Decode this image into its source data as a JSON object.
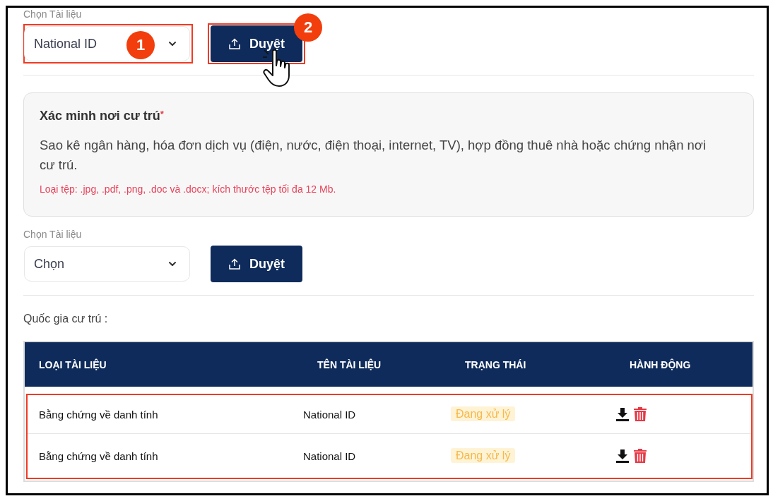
{
  "uploads": [
    {
      "label": "Chọn Tài liệu",
      "select": {
        "value": "National ID",
        "highlighted": true,
        "step": "1"
      },
      "button": {
        "label": "Duyệt",
        "highlighted": true,
        "step": "2",
        "pointer": true
      }
    },
    {
      "label": "Chọn Tài liệu",
      "select": {
        "value": "Chọn",
        "highlighted": false
      },
      "button": {
        "label": "Duyệt",
        "highlighted": false,
        "pointer": false
      }
    }
  ],
  "card": {
    "title": "Xác minh nơi cư trú",
    "required_mark": "*",
    "description": "Sao kê ngân hàng, hóa đơn dịch vụ (điện, nước, điện thoại, internet, TV), hợp đồng thuê nhà hoặc chứng nhận nơi cư trú.",
    "file_note": "Loại tệp: .jpg, .pdf, .png, .doc và .docx; kích thước tệp tối đa 12 Mb."
  },
  "country_label": "Quốc gia cư trú :",
  "table": {
    "columns": [
      "LOẠI TÀI LIỆU",
      "TÊN TÀI LIỆU",
      "TRẠNG THÁI",
      "HÀNH ĐỘNG"
    ],
    "rows_highlighted": true,
    "rows": [
      {
        "type": "Bằng chứng về danh tính",
        "name": "National ID",
        "status": "Đang xử lý"
      },
      {
        "type": "Bằng chứng về danh tính",
        "name": "National ID",
        "status": "Đang xử lý"
      }
    ]
  }
}
